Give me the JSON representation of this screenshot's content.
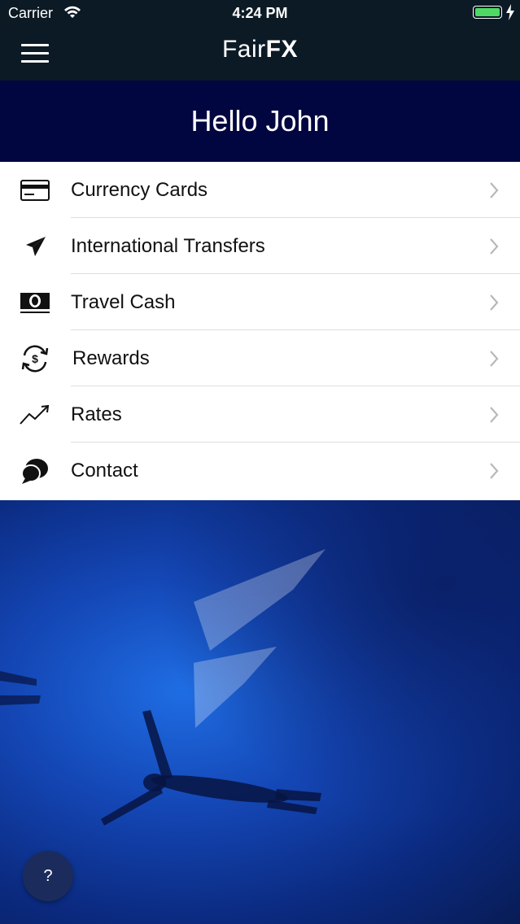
{
  "status": {
    "carrier": "Carrier",
    "time": "4:24 PM"
  },
  "header": {
    "logo_fair": "Fair",
    "logo_fx": "FX"
  },
  "greeting": "Hello John",
  "menu": {
    "items": [
      {
        "label": "Currency Cards",
        "icon": "credit-card-icon"
      },
      {
        "label": "International Transfers",
        "icon": "paper-plane-icon"
      },
      {
        "label": "Travel Cash",
        "icon": "banknote-icon"
      },
      {
        "label": "Rewards",
        "icon": "dollar-cycle-icon"
      },
      {
        "label": "Rates",
        "icon": "trend-up-icon"
      },
      {
        "label": "Contact",
        "icon": "chat-bubbles-icon"
      }
    ]
  },
  "help": {
    "label": "?"
  },
  "colors": {
    "status_bar": "#0c1a25",
    "greeting_band": "#020640",
    "battery": "#4cd964"
  }
}
